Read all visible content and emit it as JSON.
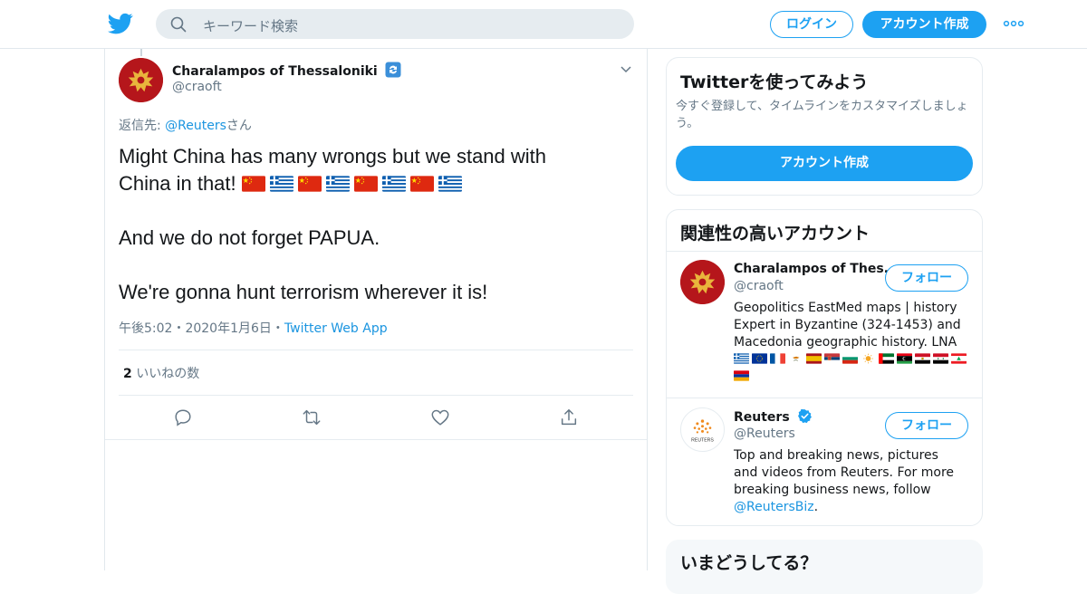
{
  "header": {
    "search_placeholder": "キーワード検索",
    "login_label": "ログイン",
    "signup_label": "アカウント作成"
  },
  "tweet": {
    "author_name": "Charalampos of Thessaloniki",
    "author_handle": "@craoft",
    "reply_prefix": "返信先: ",
    "reply_to": "@Reuters",
    "reply_suffix": "さん",
    "text_line1": "Might China has many wrongs but we stand with",
    "text_line2": "China in that!",
    "text_line3": "And we do not forget PAPUA.",
    "text_line4": "We're gonna hunt terrorism wherever it is!",
    "flags": [
      "china",
      "greece",
      "china",
      "greece",
      "china",
      "greece",
      "china",
      "greece"
    ],
    "time": "午後5:02",
    "sep1": "・",
    "date": "2020年1月6日",
    "sep2": "・",
    "source": "Twitter Web App",
    "like_count": "2",
    "like_label": "いいねの数"
  },
  "sidebar": {
    "try_title": "Twitterを使ってみよう",
    "try_sub": "今すぐ登録して、タイムラインをカスタマイズしましょう。",
    "try_button": "アカウント作成",
    "related_title": "関連性の高いアカウント",
    "accounts": [
      {
        "name": "Charalampos of Thes...",
        "handle": "@craoft",
        "follow": "フォロー",
        "bio": "Geopolitics EastMed maps | history Expert in Byzantine (324-1453) and Macedonia geographic history. LNA"
      },
      {
        "name": "Reuters",
        "handle": "@Reuters",
        "follow": "フォロー",
        "bio_text": "Top and breaking news, pictures and videos from Reuters. For more breaking business news, follow ",
        "bio_link": "@ReutersBiz",
        "bio_end": ".",
        "logo_text": "REUTERS"
      }
    ],
    "trends_title": "いまどうしてる？"
  },
  "colors": {
    "accent": "#1da1f2",
    "link": "#1b95e0",
    "muted": "#657786"
  }
}
